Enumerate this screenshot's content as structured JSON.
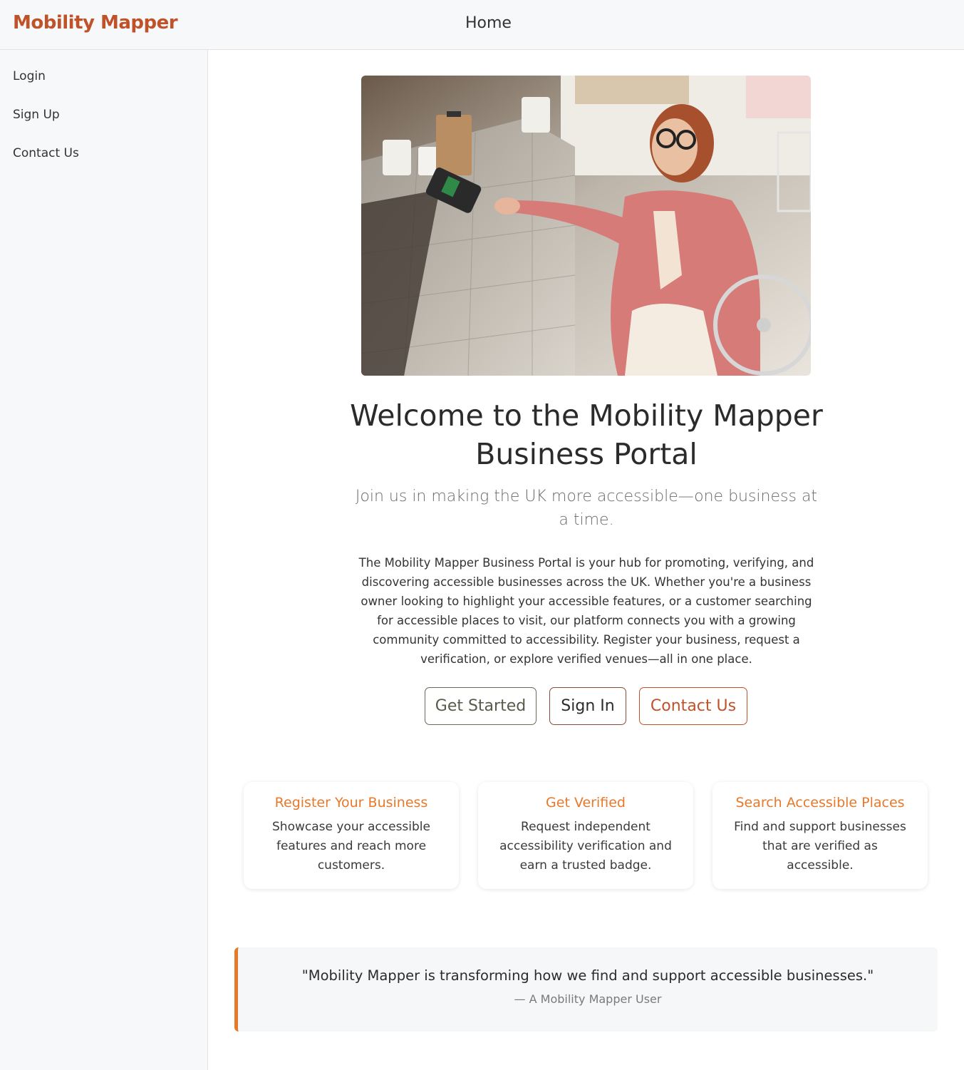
{
  "header": {
    "brand": "Mobility Mapper",
    "nav_home": "Home"
  },
  "sidebar": {
    "items": [
      {
        "label": "Login"
      },
      {
        "label": "Sign Up"
      },
      {
        "label": "Contact Us"
      }
    ]
  },
  "hero": {
    "title": "Welcome to the Mobility Mapper Business Portal",
    "subtitle": "Join us in making the UK more accessible—one business at a time.",
    "intro": "The Mobility Mapper Business Portal is your hub for promoting, verifying, and discovering accessible businesses across the UK. Whether you're a business owner looking to highlight your accessible features, or a customer searching for accessible places to visit, our platform connects you with a growing community committed to accessibility. Register your business, request a verification, or explore verified venues—all in one place.",
    "buttons": {
      "get_started": "Get Started",
      "sign_in": "Sign In",
      "contact_us": "Contact Us"
    }
  },
  "features": [
    {
      "title": "Register Your Business",
      "text": "Showcase your accessible features and reach more customers."
    },
    {
      "title": "Get Verified",
      "text": "Request independent accessibility verification and earn a trusted badge."
    },
    {
      "title": "Search Accessible Places",
      "text": "Find and support businesses that are verified as accessible."
    }
  ],
  "testimonial": {
    "quote": "\"Mobility Mapper is transforming how we find and support accessible businesses.\"",
    "author": "— A Mobility Mapper User"
  },
  "colors": {
    "brand": "#c0522a",
    "accent": "#e8782a"
  }
}
